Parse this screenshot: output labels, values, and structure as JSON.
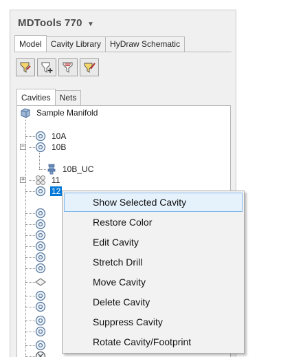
{
  "app": {
    "title": "MDTools 770",
    "dropdown_icon": "chevron-down-icon"
  },
  "main_tabs": [
    {
      "label": "Model",
      "active": true
    },
    {
      "label": "Cavity Library",
      "active": false
    },
    {
      "label": "HyDraw Schematic",
      "active": false
    }
  ],
  "toolbar": {
    "buttons": [
      {
        "icon": "cavity-filter-icon"
      },
      {
        "icon": "cavity-add-icon"
      },
      {
        "icon": "cavity-list-icon"
      },
      {
        "icon": "cavity-edit-icon"
      }
    ]
  },
  "sub_tabs": [
    {
      "label": "Cavities",
      "active": true
    },
    {
      "label": "Nets",
      "active": false
    }
  ],
  "tree": {
    "root": "Sample Manifold",
    "items": [
      {
        "label": "10A",
        "icon": "cavity-icon"
      },
      {
        "label": "10B",
        "icon": "cavity-icon",
        "expanded": true
      },
      {
        "label": "10B_UC",
        "icon": "component-icon"
      },
      {
        "label": "11",
        "icon": "cavity-group-icon",
        "expanded": false
      },
      {
        "label": "12",
        "icon": "cavity-icon",
        "selected": true
      }
    ],
    "selected_color": "#0078d7"
  },
  "context_menu": {
    "items": [
      {
        "label": "Show Selected Cavity",
        "highlighted": true
      },
      {
        "label": "Restore Color"
      },
      {
        "label": "Edit Cavity"
      },
      {
        "label": "Stretch Drill"
      },
      {
        "label": "Move Cavity"
      },
      {
        "label": "Delete Cavity"
      },
      {
        "label": "Suppress Cavity"
      },
      {
        "label": "Rotate Cavity/Footprint"
      }
    ],
    "highlight_color": "#e5f1fb"
  }
}
